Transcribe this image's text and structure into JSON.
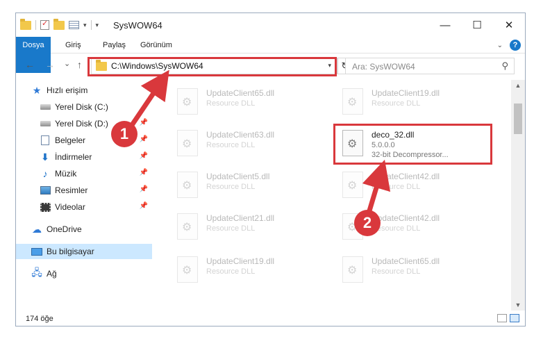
{
  "window": {
    "title": "SysWOW64",
    "minimize": "—",
    "maximize": "☐",
    "close": "✕"
  },
  "ribbon": {
    "tabs": [
      "Dosya",
      "Giriş",
      "Paylaş",
      "Görünüm"
    ],
    "help": "?"
  },
  "nav": {
    "back": "←",
    "forward": "→",
    "recent": "⌄",
    "up": "↑",
    "address": "C:\\Windows\\SysWOW64",
    "refresh": "↻",
    "search_placeholder": "Ara: SysWOW64"
  },
  "sidebar": {
    "items": [
      {
        "label": "Hızlı erişim",
        "icon": "star-icon"
      },
      {
        "label": "Yerel Disk (C:)",
        "icon": "disk-icon",
        "pinned": true
      },
      {
        "label": "Yerel Disk (D:)",
        "icon": "disk-icon",
        "pinned": true
      },
      {
        "label": "Belgeler",
        "icon": "documents-icon",
        "pinned": true
      },
      {
        "label": "İndirmeler",
        "icon": "download-icon",
        "pinned": true
      },
      {
        "label": "Müzik",
        "icon": "music-icon",
        "pinned": true
      },
      {
        "label": "Resimler",
        "icon": "pictures-icon",
        "pinned": true
      },
      {
        "label": "Videolar",
        "icon": "videos-icon",
        "pinned": true
      },
      {
        "label": "OneDrive",
        "icon": "cloud-icon"
      },
      {
        "label": "Bu bilgisayar",
        "icon": "computer-icon",
        "selected": true
      },
      {
        "label": "Ağ",
        "icon": "network-icon"
      }
    ]
  },
  "files": [
    {
      "name": "UpdateClient65.dll",
      "line1": "Resource DLL",
      "line2": ""
    },
    {
      "name": "UpdateClient19.dll",
      "line1": "Resource DLL",
      "line2": ""
    },
    {
      "name": "UpdateClient63.dll",
      "line1": "Resource DLL",
      "line2": ""
    },
    {
      "name": "deco_32.dll",
      "line1": "5.0.0.0",
      "line2": "32-bit Decompressor..."
    },
    {
      "name": "UpdateClient5.dll",
      "line1": "Resource DLL",
      "line2": ""
    },
    {
      "name": "UpdateClient42.dll",
      "line1": "Resource DLL",
      "line2": ""
    },
    {
      "name": "UpdateClient21.dll",
      "line1": "Resource DLL",
      "line2": ""
    },
    {
      "name": "UpdateClient42.dll",
      "line1": "Resource DLL",
      "line2": ""
    },
    {
      "name": "UpdateClient19.dll",
      "line1": "Resource DLL",
      "line2": ""
    },
    {
      "name": "UpdateClient65.dll",
      "line1": "Resource DLL",
      "line2": ""
    }
  ],
  "status": {
    "count": "174 öğe"
  },
  "callouts": [
    "1",
    "2"
  ],
  "colors": {
    "accent": "#1979ca",
    "callout": "#d9383c",
    "selected": "#cce8ff"
  }
}
